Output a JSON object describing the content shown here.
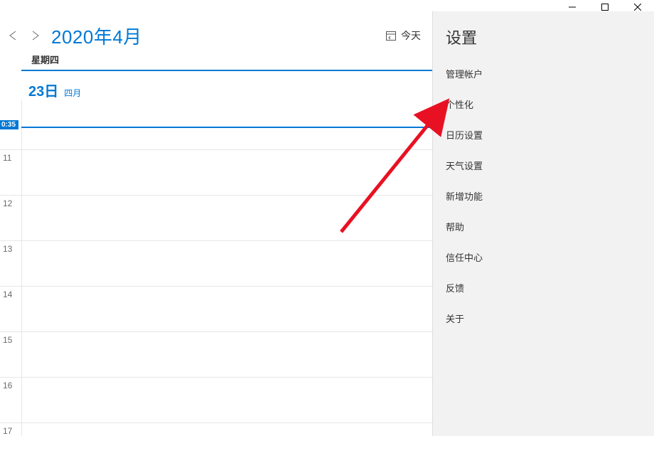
{
  "header": {
    "title": "2020年4月",
    "today": "今天"
  },
  "day": {
    "weekday": "星期四",
    "date": "23日",
    "month": "四月"
  },
  "now": {
    "label": "0:35"
  },
  "hours": [
    "11",
    "12",
    "13",
    "14",
    "15",
    "16",
    "17"
  ],
  "settings": {
    "title": "设置",
    "items": [
      "管理帐户",
      "个性化",
      "日历设置",
      "天气设置",
      "新增功能",
      "帮助",
      "信任中心",
      "反馈",
      "关于"
    ]
  }
}
